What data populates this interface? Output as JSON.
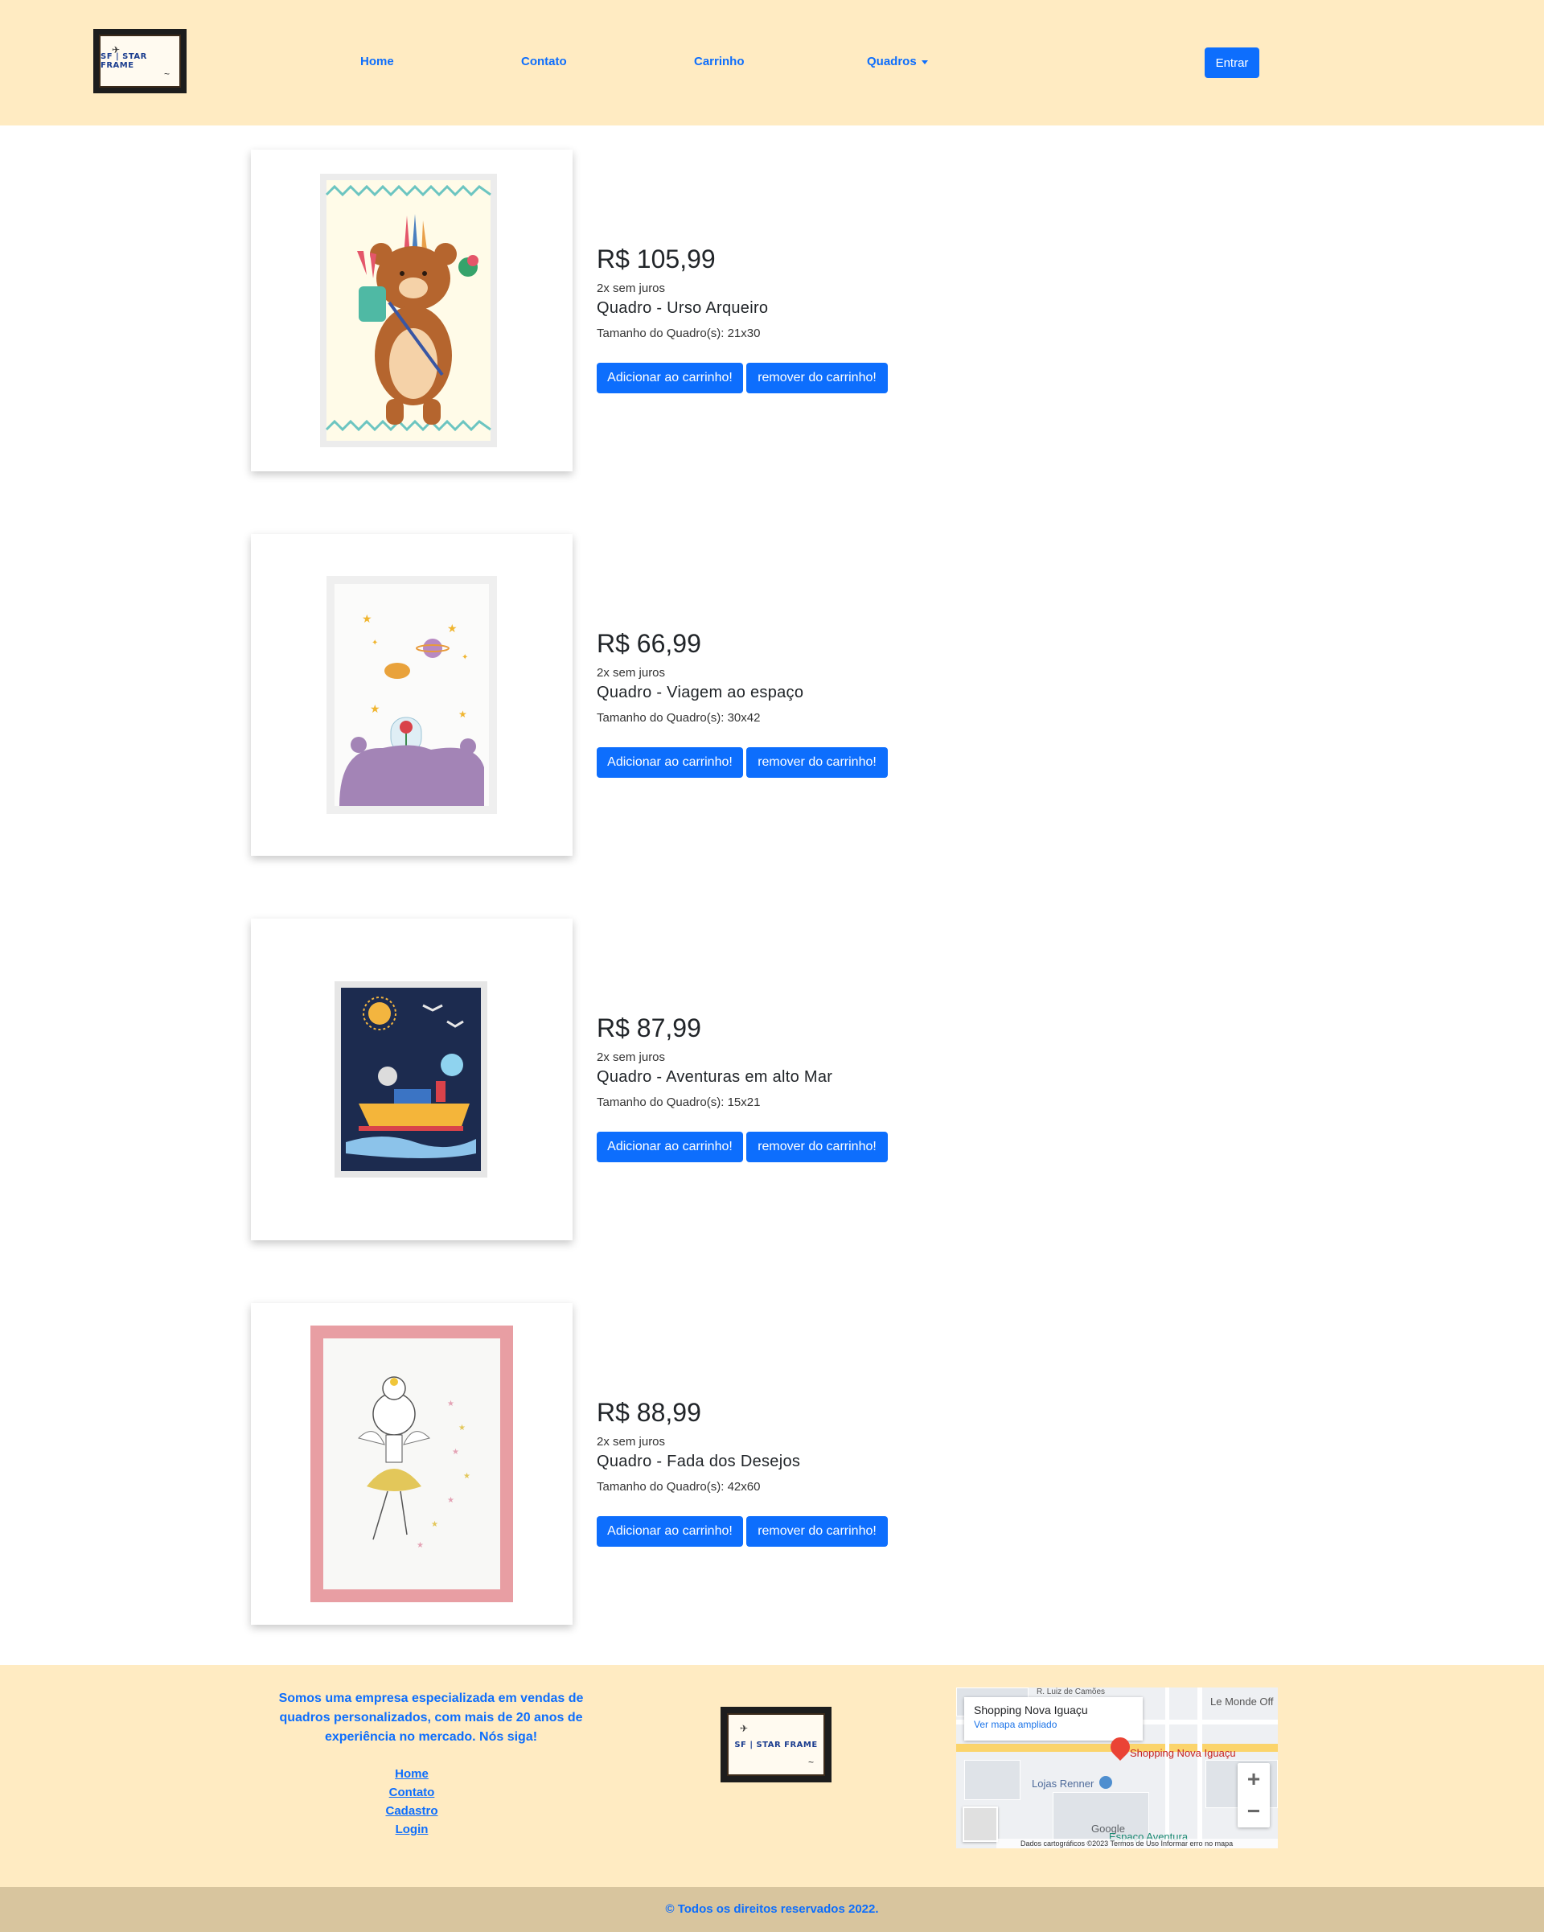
{
  "header": {
    "logo_text": "SF | STAR FRAME",
    "nav": {
      "home": "Home",
      "contato": "Contato",
      "carrinho": "Carrinho",
      "quadros": "Quadros"
    },
    "login_label": "Entrar"
  },
  "products": [
    {
      "price": "R$ 105,99",
      "installments": "2x sem juros",
      "name": "Quadro - Urso Arqueiro",
      "size": "Tamanho do Quadro(s): 21x30",
      "add_label": "Adicionar ao carrinho!",
      "remove_label": "remover do carrinho!"
    },
    {
      "price": "R$ 66,99",
      "installments": "2x sem juros",
      "name": "Quadro - Viagem ao espaço",
      "size": "Tamanho do Quadro(s): 30x42",
      "add_label": "Adicionar ao carrinho!",
      "remove_label": "remover do carrinho!"
    },
    {
      "price": "R$ 87,99",
      "installments": "2x sem juros",
      "name": "Quadro - Aventuras em alto Mar",
      "size": "Tamanho do Quadro(s): 15x21",
      "add_label": "Adicionar ao carrinho!",
      "remove_label": "remover do carrinho!"
    },
    {
      "price": "R$ 88,99",
      "installments": "2x sem juros",
      "name": "Quadro - Fada dos Desejos",
      "size": "Tamanho do Quadro(s): 42x60",
      "add_label": "Adicionar ao carrinho!",
      "remove_label": "remover do carrinho!"
    }
  ],
  "footer": {
    "about": "Somos uma empresa especializada em vendas de quadros personalizados, com mais de 20 anos de experiência no mercado. Nós siga!",
    "links": {
      "home": "Home",
      "contato": "Contato",
      "cadastro": "Cadastro",
      "login": "Login"
    },
    "map": {
      "place_title": "Shopping Nova Iguaçu",
      "view_larger": "Ver mapa ampliado",
      "pin_label": "Shopping Nova Iguaçu",
      "lojas": "Lojas Renner",
      "espaco": "Espaço Aventura",
      "le_monde": "Le Monde Off",
      "street": "R. Luiz de Camões",
      "google": "Google",
      "bottom_text": "Dados cartográficos ©2023   Termos de Uso   Informar erro no mapa"
    },
    "copyright": "© Todos os direitos reservados 2022."
  },
  "colors": {
    "header_bg": "#ffebc2",
    "primary": "#0d6efd",
    "copyright_bg": "#d8c59e"
  }
}
